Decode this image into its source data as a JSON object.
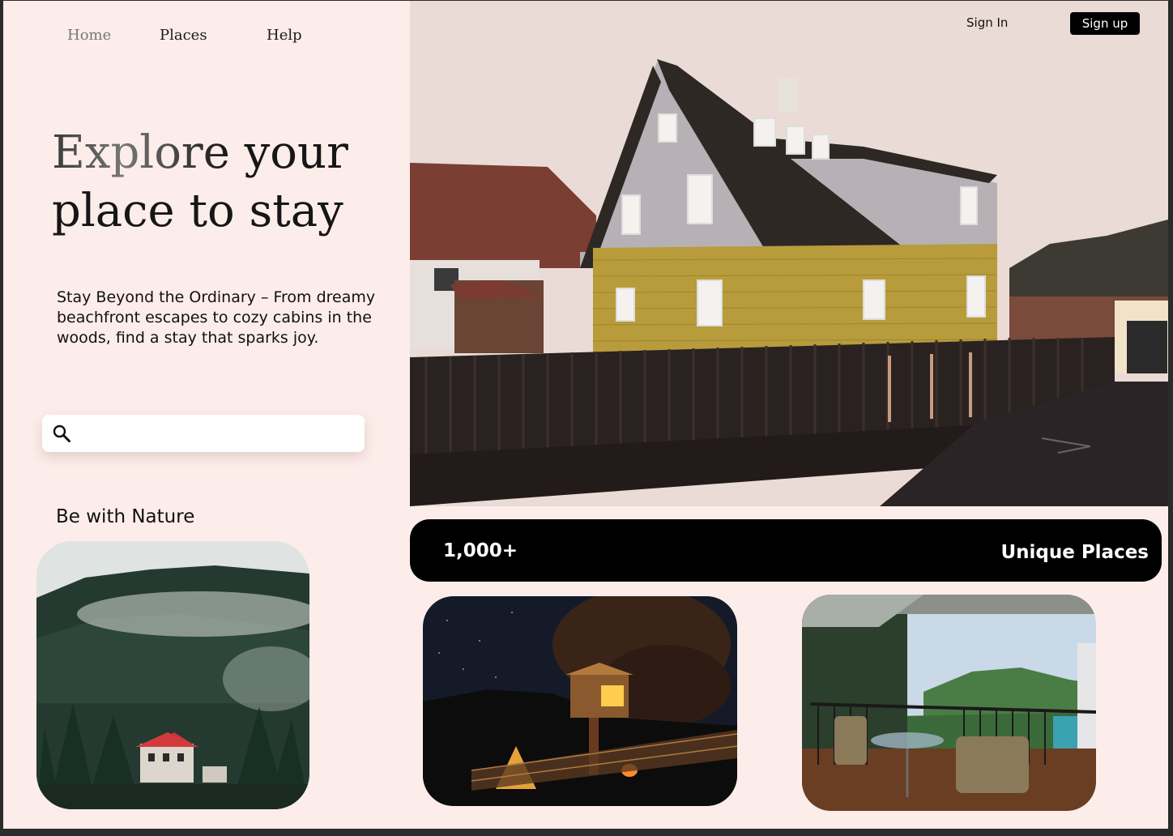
{
  "nav": {
    "home": "Home",
    "places": "Places",
    "help": "Help"
  },
  "auth": {
    "sign_in": "Sign In",
    "sign_up": "Sign up"
  },
  "hero": {
    "title_line1_fade": "Explore",
    "title_line1_rest": " your",
    "title_line2": "place to stay",
    "tagline": "Stay Beyond the Ordinary – From dreamy beachfront escapes to cozy cabins in the woods, find a stay that sparks joy."
  },
  "search": {
    "placeholder": "",
    "value": "",
    "icon": "search-icon"
  },
  "nature": {
    "title": "Be with Nature"
  },
  "stats": {
    "count": "1,000+",
    "label": "Unique Places"
  },
  "colors": {
    "background": "#fcedea",
    "accent": "#000000",
    "text": "#111111"
  }
}
